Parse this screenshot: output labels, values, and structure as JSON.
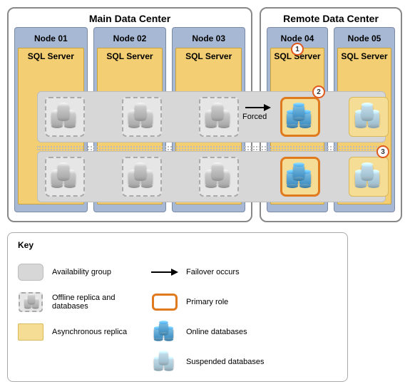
{
  "datacenters": {
    "main": {
      "title": "Main Data Center",
      "nodes": [
        "Node 01",
        "Node 02",
        "Node 03"
      ]
    },
    "remote": {
      "title": "Remote Data Center",
      "nodes": [
        "Node 04",
        "Node 05"
      ]
    }
  },
  "sql_label": "SQL Server",
  "forced_label": "Forced",
  "callouts": {
    "c1": "1",
    "c2": "2",
    "c3": "3"
  },
  "availability_groups": [
    {
      "id": "ag1",
      "replicas": [
        {
          "node": "Node 01",
          "state": "offline",
          "db_state": "offline"
        },
        {
          "node": "Node 02",
          "state": "offline",
          "db_state": "offline"
        },
        {
          "node": "Node 03",
          "state": "offline",
          "db_state": "offline"
        },
        {
          "node": "Node 04",
          "state": "primary",
          "db_state": "online",
          "callout": 2,
          "forced_failover_target": true
        },
        {
          "node": "Node 05",
          "state": "async",
          "db_state": "suspended"
        }
      ]
    },
    {
      "id": "ag2",
      "replicas": [
        {
          "node": "Node 01",
          "state": "offline",
          "db_state": "offline"
        },
        {
          "node": "Node 02",
          "state": "offline",
          "db_state": "offline"
        },
        {
          "node": "Node 03",
          "state": "offline",
          "db_state": "offline"
        },
        {
          "node": "Node 04",
          "state": "primary",
          "db_state": "online"
        },
        {
          "node": "Node 05",
          "state": "async",
          "db_state": "suspended",
          "callout": 3
        }
      ]
    }
  ],
  "key": {
    "title": "Key",
    "items": {
      "ag": "Availability group",
      "offline": "Offline replica and databases",
      "async": "Asynchronous replica",
      "failover": "Failover occurs",
      "primary": "Primary role",
      "online_db": "Online databases",
      "suspended_db": "Suspended databases"
    }
  }
}
